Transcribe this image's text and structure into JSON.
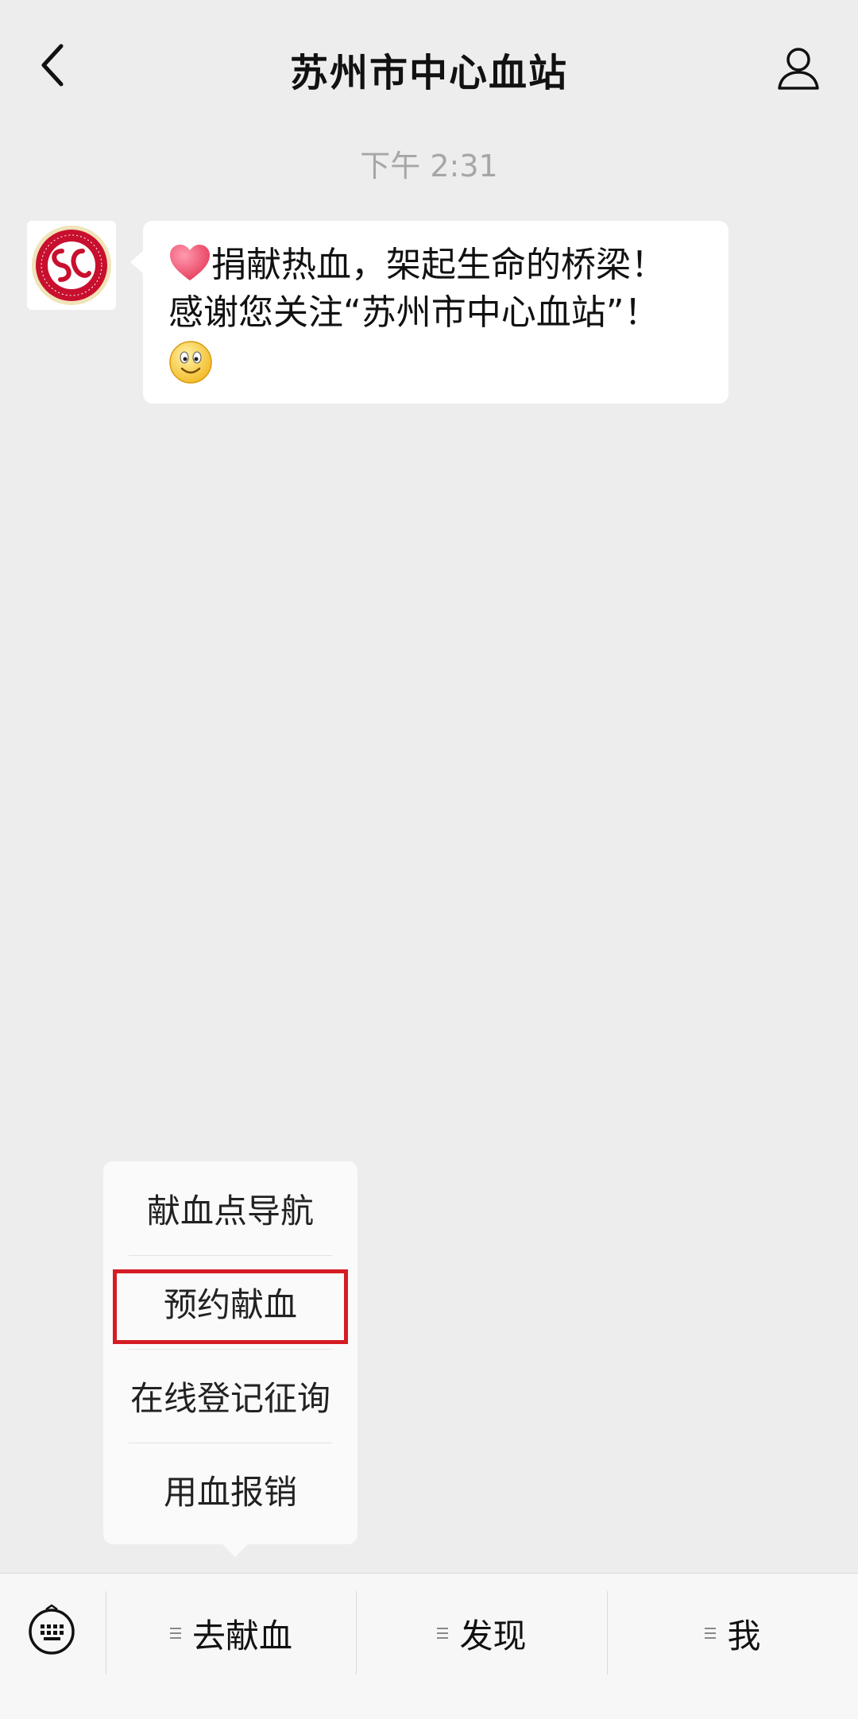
{
  "header": {
    "title": "苏州市中心血站"
  },
  "chat": {
    "timestamp": "下午 2:31",
    "message": {
      "line1": "捐献热血，架起生命的桥梁！",
      "line2": "感谢您关注“苏州市中心血站”！"
    }
  },
  "popup_menu": {
    "items": [
      {
        "label": "献血点导航"
      },
      {
        "label": "预约献血"
      },
      {
        "label": "在线登记征询"
      },
      {
        "label": "用血报销"
      }
    ]
  },
  "bottom_bar": {
    "tabs": [
      {
        "label": "去献血"
      },
      {
        "label": "发现"
      },
      {
        "label": "我"
      }
    ]
  },
  "colors": {
    "background": "#ededed",
    "highlight": "#d51c24",
    "logo_red": "#c8102e"
  }
}
